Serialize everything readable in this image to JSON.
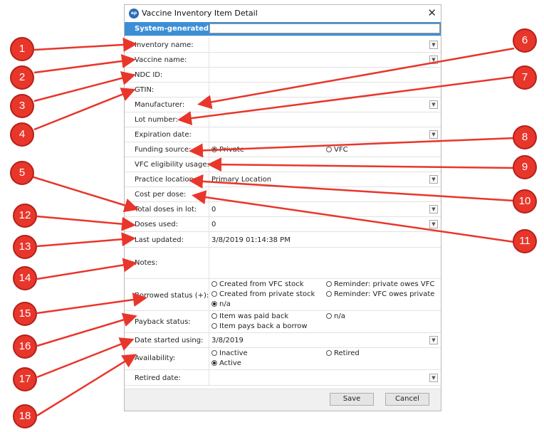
{
  "window": {
    "title": "Vaccine Inventory Item Detail",
    "close_glyph": "✕",
    "icon_text": "ep"
  },
  "colors": {
    "header_bg": "#3c8fd6",
    "badge_red": "#e8362b",
    "arrow_red": "#e8362b"
  },
  "fields": {
    "system_id_label": "System-generated ID",
    "inventory_name": "Inventory name:",
    "vaccine_name": "Vaccine name:",
    "ndc_id": "NDC ID:",
    "gtin": "GTIN:",
    "manufacturer": "Manufacturer:",
    "lot_number": "Lot number:",
    "expiration_date": "Expiration date:",
    "funding_source": "Funding source:",
    "vfc_eligibility": "VFC eligibility usage:",
    "practice_location": "Practice location:",
    "practice_location_value": "Primary Location",
    "cost_per_dose": "Cost per dose:",
    "total_doses": "Total doses in lot:",
    "total_doses_value": "0",
    "doses_used": "Doses used:",
    "doses_used_value": "0",
    "last_updated": "Last updated:",
    "last_updated_value": "3/8/2019 01:14:38 PM",
    "notes": "Notes:",
    "borrowed_status": "Borrowed status (+):",
    "payback_status": "Payback status:",
    "date_started": "Date started using:",
    "date_started_value": "3/8/2019",
    "availability": "Availability:",
    "retired_date": "Retired date:"
  },
  "radios": {
    "funding_private": "Private",
    "funding_vfc": "VFC",
    "borrowed_vfc_stock": "Created from VFC stock",
    "borrowed_private_stock": "Created from private stock",
    "borrowed_na": "n/a",
    "borrowed_private_owes": "Reminder: private owes VFC",
    "borrowed_vfc_owes": "Reminder: VFC owes private",
    "payback_paid": "Item was paid back",
    "payback_pays": "Item pays back a borrow",
    "payback_na": "n/a",
    "avail_inactive": "Inactive",
    "avail_active": "Active",
    "avail_retired": "Retired"
  },
  "buttons": {
    "save": "Save",
    "cancel": "Cancel"
  },
  "badges": [
    "1",
    "2",
    "3",
    "4",
    "5",
    "6",
    "7",
    "8",
    "9",
    "10",
    "11",
    "12",
    "13",
    "14",
    "15",
    "16",
    "17",
    "18"
  ]
}
